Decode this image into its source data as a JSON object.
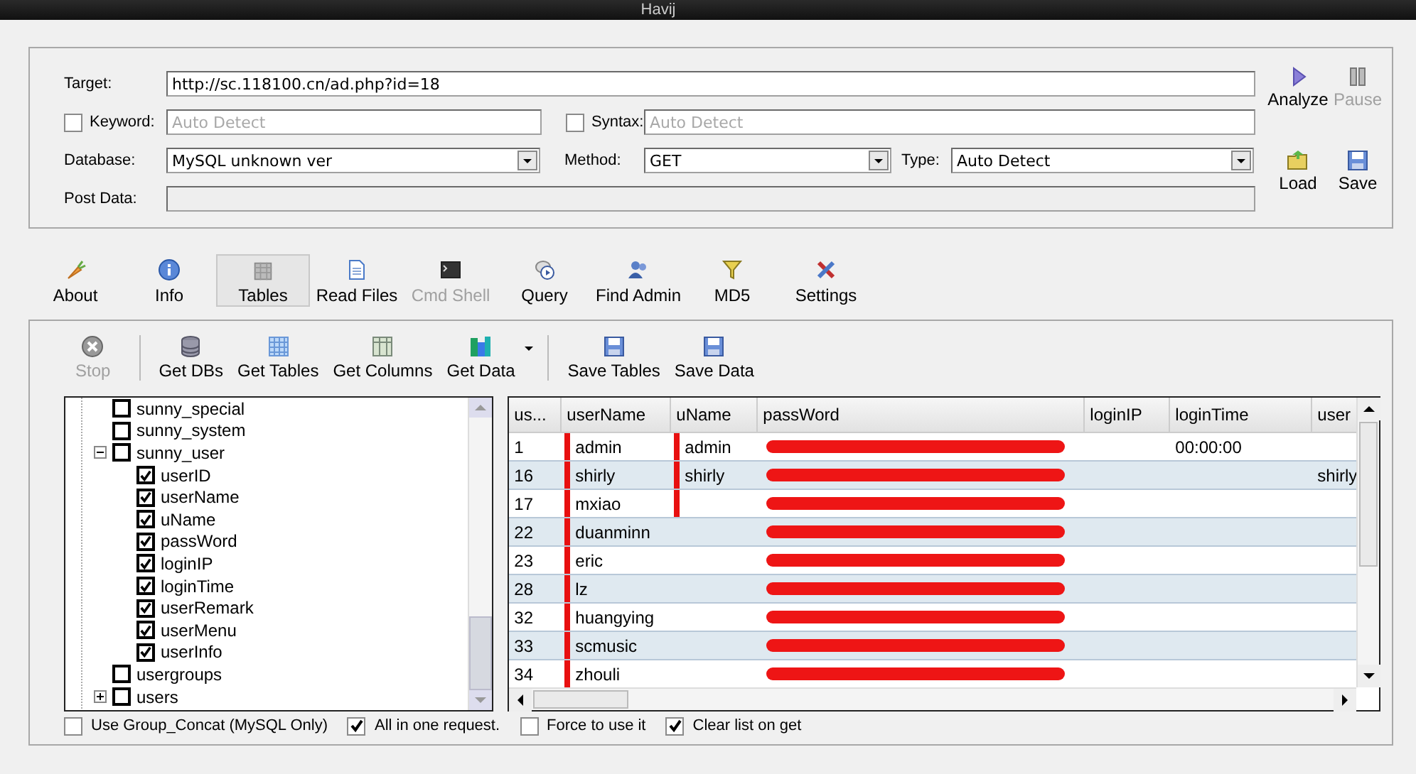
{
  "window": {
    "title": "Havij"
  },
  "form": {
    "target": {
      "label": "Target:",
      "value": "http://sc.118100.cn/ad.php?id=18"
    },
    "keyword": {
      "label": "Keyword:",
      "checked": false,
      "placeholder": "Auto Detect"
    },
    "syntax": {
      "label": "Syntax:",
      "checked": false,
      "placeholder": "Auto Detect"
    },
    "database": {
      "label": "Database:",
      "value": "MySQL unknown ver"
    },
    "method": {
      "label": "Method:",
      "value": "GET"
    },
    "type": {
      "label": "Type:",
      "value": "Auto Detect"
    },
    "post_data": {
      "label": "Post Data:",
      "disabled": true
    }
  },
  "actions": [
    {
      "label": "Analyze",
      "disabled": false
    },
    {
      "label": "Pause",
      "disabled": true
    },
    {
      "label": "Load",
      "disabled": false
    },
    {
      "label": "Save",
      "disabled": false
    }
  ],
  "tabs": [
    {
      "label": "About",
      "selected": false,
      "disabled": false
    },
    {
      "label": "Info",
      "selected": false,
      "disabled": false
    },
    {
      "label": "Tables",
      "selected": true,
      "disabled": false
    },
    {
      "label": "Read Files",
      "selected": false,
      "disabled": false
    },
    {
      "label": "Cmd Shell",
      "selected": false,
      "disabled": true
    },
    {
      "label": "Query",
      "selected": false,
      "disabled": false
    },
    {
      "label": "Find Admin",
      "selected": false,
      "disabled": false
    },
    {
      "label": "MD5",
      "selected": false,
      "disabled": false
    },
    {
      "label": "Settings",
      "selected": false,
      "disabled": false
    }
  ],
  "toolbar": [
    {
      "label": "Stop",
      "disabled": true,
      "dropdown": false
    },
    {
      "label": "Get DBs",
      "disabled": false,
      "dropdown": false
    },
    {
      "label": "Get Tables",
      "disabled": false,
      "dropdown": false
    },
    {
      "label": "Get Columns",
      "disabled": false,
      "dropdown": false
    },
    {
      "label": "Get Data",
      "disabled": false,
      "dropdown": true
    },
    {
      "label": "Save Tables",
      "disabled": false,
      "dropdown": false
    },
    {
      "label": "Save Data",
      "disabled": false,
      "dropdown": false
    }
  ],
  "tree": [
    {
      "label": "sunny_special",
      "checked": false
    },
    {
      "label": "sunny_system",
      "checked": false
    },
    {
      "label": "sunny_user",
      "checked": false,
      "expanded": true,
      "children": [
        {
          "label": "userID",
          "checked": true
        },
        {
          "label": "userName",
          "checked": true
        },
        {
          "label": "uName",
          "checked": true
        },
        {
          "label": "passWord",
          "checked": true
        },
        {
          "label": "loginIP",
          "checked": true
        },
        {
          "label": "loginTime",
          "checked": true
        },
        {
          "label": "userRemark",
          "checked": true
        },
        {
          "label": "userMenu",
          "checked": true
        },
        {
          "label": "userInfo",
          "checked": true
        }
      ]
    },
    {
      "label": "usergroups",
      "checked": false
    },
    {
      "label": "users",
      "checked": false,
      "expanded": false
    }
  ],
  "table": {
    "columns": [
      "us...",
      "userName",
      "uName",
      "passWord",
      "loginIP",
      "loginTime",
      "user"
    ],
    "rows": [
      {
        "id": "1",
        "user_name": "admin",
        "u_name": "admin",
        "password_redacted": true,
        "login_time": "00:00:00",
        "user_name_struck": true,
        "u_name_struck": true
      },
      {
        "id": "16",
        "user_name": "shirly",
        "u_name": "shirly",
        "password_redacted": true,
        "column_7": "shirly",
        "user_name_struck": true,
        "u_name_struck": true
      },
      {
        "id": "17",
        "user_name": "mxiao",
        "password_redacted": true,
        "user_name_struck": true,
        "u_name_struck": true
      },
      {
        "id": "22",
        "user_name": "duanminn",
        "password_redacted": true,
        "user_name_struck": true
      },
      {
        "id": "23",
        "user_name": "eric",
        "password_redacted": true,
        "user_name_struck": true
      },
      {
        "id": "28",
        "user_name": "lz",
        "password_redacted": true,
        "user_name_struck": true
      },
      {
        "id": "32",
        "user_name": "huangying",
        "password_redacted": true,
        "user_name_struck": true
      },
      {
        "id": "33",
        "user_name": "scmusic",
        "password_redacted": true,
        "user_name_struck": true
      },
      {
        "id": "34",
        "user_name": "zhouli",
        "password_redacted": true,
        "user_name_struck": true
      }
    ]
  },
  "options": [
    {
      "label": "Use Group_Concat (MySQL Only)",
      "checked": false
    },
    {
      "label": "All in one request.",
      "checked": true
    },
    {
      "label": "Force to use it",
      "checked": false
    },
    {
      "label": "Clear list on get",
      "checked": true
    }
  ]
}
